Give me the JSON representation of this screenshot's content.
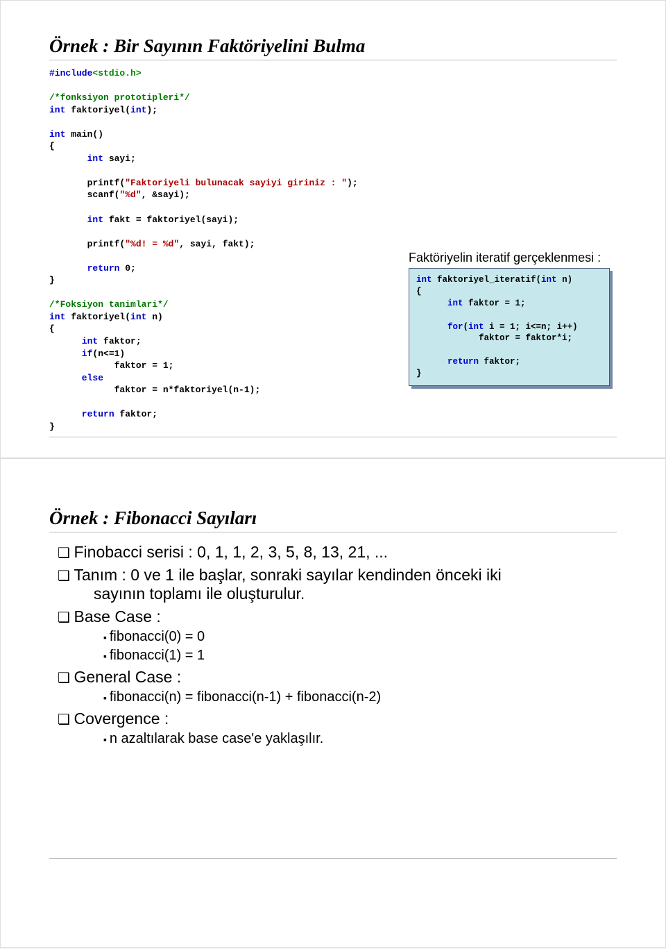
{
  "slide1": {
    "title": "Örnek : Bir Sayının Faktöriyelini Bulma",
    "code": {
      "l1_a": "#include",
      "l1_b": "<stdio.h>",
      "l2": "/*fonksiyon prototipleri*/",
      "l3_a": "int",
      "l3_b": " faktoriyel(",
      "l3_c": "int",
      "l3_d": ");",
      "l4_a": "int",
      "l4_b": " main()",
      "l5": "{",
      "l6_a": "       int",
      "l6_b": " sayi;",
      "l7_a": "       printf(",
      "l7_b": "\"Faktoriyeli bulunacak sayiyi giriniz : \"",
      "l7_c": ");",
      "l8_a": "       scanf(",
      "l8_b": "\"%d\"",
      "l8_c": ", &sayi);",
      "l9_a": "       int",
      "l9_b": " fakt = faktoriyel(sayi);",
      "l10_a": "       printf(",
      "l10_b": "\"%d! = %d\"",
      "l10_c": ", sayi, fakt);",
      "l11_a": "       return",
      "l11_b": " 0;",
      "l12": "}",
      "l13": "/*Foksiyon tanimlari*/",
      "l14_a": "int",
      "l14_b": " faktoriyel(",
      "l14_c": "int",
      "l14_d": " n)",
      "l15": "{",
      "l16_a": "      int",
      "l16_b": " faktor;",
      "l17_a": "      if",
      "l17_b": "(n<=1)",
      "l18": "            faktor = 1;",
      "l19": "      else",
      "l20": "            faktor = n*faktoriyel(n-1);",
      "l21_a": "      return",
      "l21_b": " faktor;",
      "l22": "}"
    },
    "side_title": "Faktöriyelin iteratif gerçeklenmesi :",
    "side_code": {
      "s1_a": "int",
      "s1_b": " faktoriyel_iteratif(",
      "s1_c": "int",
      "s1_d": " n)",
      "s2": "{",
      "s3_a": "      int",
      "s3_b": " faktor = 1;",
      "s4_a": "      for",
      "s4_b": "(",
      "s4_c": "int",
      "s4_d": " i = 1; i<=n; i++)",
      "s5": "            faktor = faktor*i;",
      "s6_a": "      return",
      "s6_b": " faktor;",
      "s7": "}"
    }
  },
  "slide2": {
    "title": "Örnek : Fibonacci Sayıları",
    "bullets": {
      "b1": "Finobacci serisi : 0, 1, 1, 2, 3, 5, 8, 13, 21, ...",
      "b2_l1": "Tanım : 0 ve 1 ile başlar, sonraki sayılar kendinden önceki iki",
      "b2_l2": "sayının toplamı ile oluşturulur.",
      "b3": "Base Case :",
      "b3_s1": "fibonacci(0) = 0",
      "b3_s2": "fibonacci(1) = 1",
      "b4": "General Case :",
      "b4_s1": "fibonacci(n) = fibonacci(n-1) + fibonacci(n-2)",
      "b5": "Covergence :",
      "b5_s1": "n azaltılarak base case'e yaklaşılır."
    }
  }
}
